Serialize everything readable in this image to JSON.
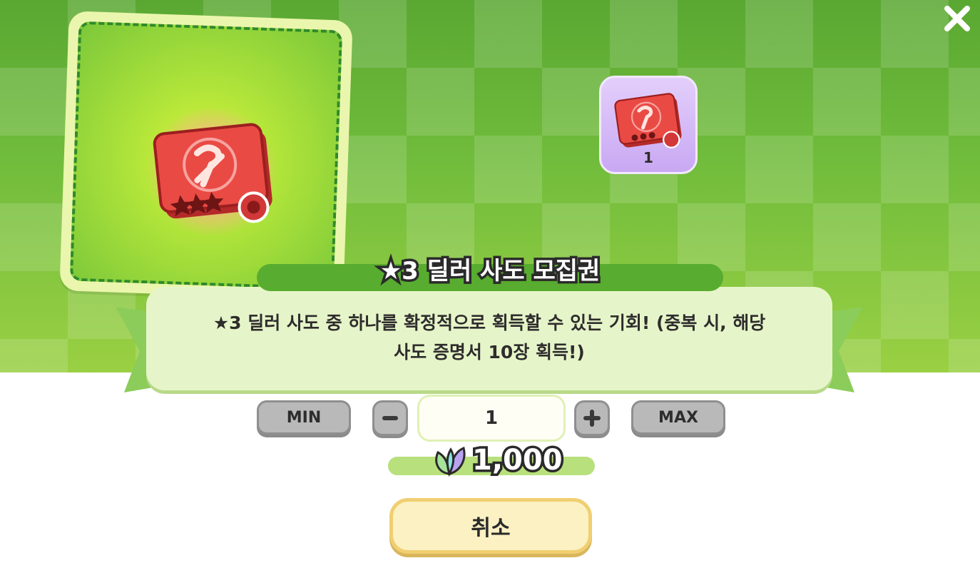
{
  "item": {
    "title": "★3 딜러 사도 모집권",
    "description_line1": "★3 딜러 사도 중 하나를 확정적으로 획득할 수 있는 기회! (중복 시, 해당",
    "description_line2": "사도 증명서 10장 획득!)",
    "owned_count": "1",
    "icon": "red-ticket-icon"
  },
  "quantity": {
    "min_label": "MIN",
    "max_label": "MAX",
    "value": "1",
    "decrement_icon": "minus-icon",
    "increment_icon": "plus-icon"
  },
  "price": {
    "amount": "1,000",
    "currency_icon": "crystal-leaf-icon"
  },
  "actions": {
    "cancel_label": "취소",
    "close_icon": "close-icon"
  },
  "colors": {
    "background_green": "#72bd3c",
    "title_bar": "#58ac2f",
    "panel": "#e6f5c9",
    "preview_purple": "#c9a8f3",
    "cancel_button": "#fbf1c3"
  }
}
